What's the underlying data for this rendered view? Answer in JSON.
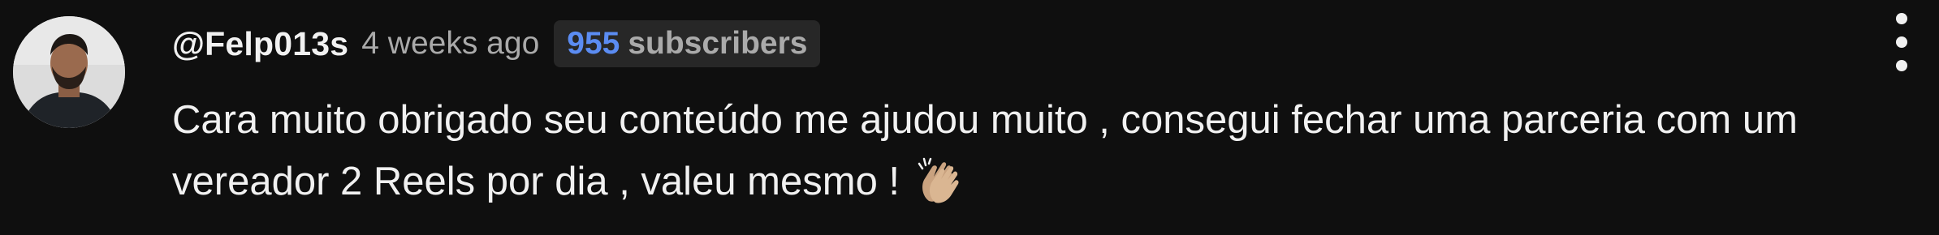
{
  "comment": {
    "author": "@Felp013s",
    "time": "4 weeks ago",
    "badge": {
      "count": "955",
      "label": "subscribers"
    },
    "text_lines": [
      "Cara muito obrigado seu conteúdo me ajudou muito , consegui fechar uma parceria com um",
      "vereador 2 Reels por dia , valeu mesmo ! "
    ],
    "emoji": "clapping-hands-icon"
  },
  "colors": {
    "background": "#0f0f0f",
    "text": "#f1f1f1",
    "secondary": "#aaaaaa",
    "badge_bg": "#272727",
    "badge_accent": "#5b8cf2"
  }
}
